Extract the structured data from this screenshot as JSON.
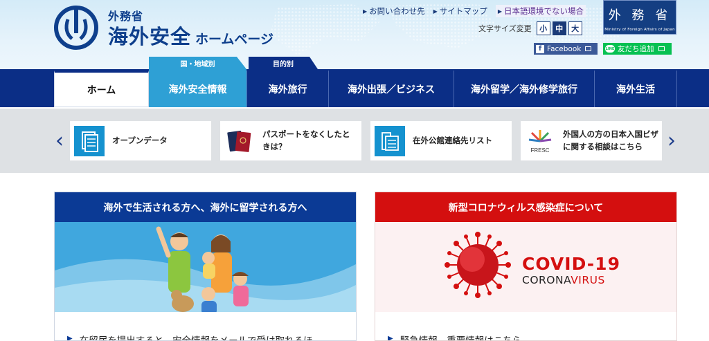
{
  "header": {
    "ministry_name": "外務省",
    "site_title": "海外安全",
    "site_title_sub": "ホームページ",
    "util_links": [
      {
        "label": "お問い合わせ先"
      },
      {
        "label": "サイトマップ"
      },
      {
        "label": "日本語環境でない場合"
      }
    ],
    "mofa_badge": {
      "jp": "外 務 省",
      "en": "Ministry of Foreign Affairs of Japan"
    },
    "font_size": {
      "label": "文字サイズ変更",
      "options": [
        "小",
        "中",
        "大"
      ],
      "selected": "中"
    },
    "facebook_label": "Facebook",
    "line_label": "友だち追加",
    "line_logo_text": "LINE"
  },
  "nav": {
    "category_tags": {
      "region": "国・地域別",
      "purpose": "目的別"
    },
    "items": [
      {
        "label": "ホーム"
      },
      {
        "label": "海外安全情報"
      },
      {
        "label": "海外旅行"
      },
      {
        "label": "海外出張／ビジネス"
      },
      {
        "label": "海外留学／海外修学旅行"
      },
      {
        "label": "海外生活"
      }
    ],
    "active": "ホーム"
  },
  "banners": {
    "prev_icon": "chevron-left-icon",
    "next_icon": "chevron-right-icon",
    "items": [
      {
        "label": "オープンデータ",
        "icon": "open-data-icon"
      },
      {
        "label": "パスポートをなくしたときは？",
        "icon": "passport-icon"
      },
      {
        "label": "在外公館連絡先リスト",
        "icon": "embassy-list-icon"
      },
      {
        "label": "外国人の方の日本入国ビザに関する相談はこちら",
        "icon": "fresc-logo",
        "logo_text": "FRESC"
      }
    ]
  },
  "panels": {
    "left": {
      "title": "海外で生活される方へ、海外に留学される方へ",
      "link": "在留届を提出すると、安全情報をメールで受け取れるほ"
    },
    "right": {
      "title": "新型コロナウィルス感染症について",
      "covid_title": "COVID-19",
      "covid_sub_a": "CORONA",
      "covid_sub_b": "VIRUS",
      "link": "緊急情報、重要情報はこちら"
    }
  },
  "colors": {
    "navy": "#0b2e86",
    "cyan": "#2ea0d5",
    "covid_red": "#d40f0f",
    "facebook": "#3b5998",
    "line": "#06c152"
  }
}
